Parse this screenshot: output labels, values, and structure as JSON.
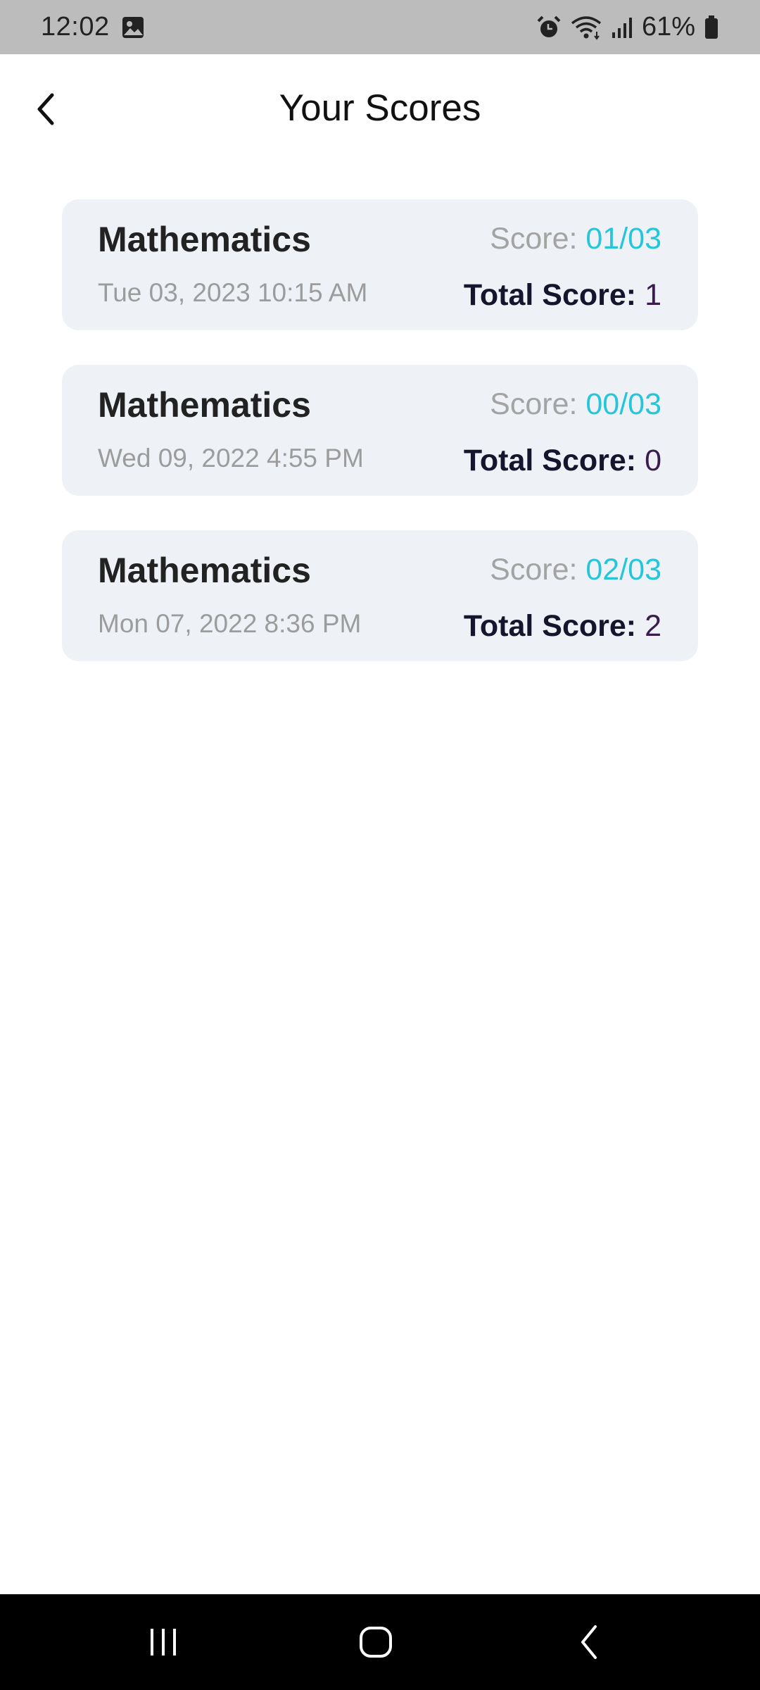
{
  "status_bar": {
    "time": "12:02",
    "battery": "61%",
    "icons": [
      "gallery-icon",
      "alarm-icon",
      "wifi-icon",
      "signal-icon",
      "battery-icon"
    ]
  },
  "header": {
    "title": "Your Scores",
    "back_icon": "chevron-left-icon"
  },
  "score_cards": [
    {
      "subject": "Mathematics",
      "date": "Tue 03, 2023 10:15 AM",
      "score_label": "Score: ",
      "score_value": "01/03",
      "total_label": "Total Score:",
      "total_value": "1"
    },
    {
      "subject": "Mathematics",
      "date": "Wed 09, 2022 4:55 PM",
      "score_label": "Score: ",
      "score_value": "00/03",
      "total_label": "Total Score:",
      "total_value": "0"
    },
    {
      "subject": "Mathematics",
      "date": "Mon 07, 2022 8:36 PM",
      "score_label": "Score: ",
      "score_value": "02/03",
      "total_label": "Total Score:",
      "total_value": "2"
    }
  ],
  "nav_bar": {
    "buttons": [
      "recents-icon",
      "home-icon",
      "back-icon"
    ]
  },
  "colors": {
    "status_bar": "#bcbcbc",
    "card_background": "#eef2f6",
    "score_accent": "#26c6da",
    "total_label": "#15152d",
    "total_value": "#3a1d4e",
    "muted_text": "#9c9c9c"
  }
}
